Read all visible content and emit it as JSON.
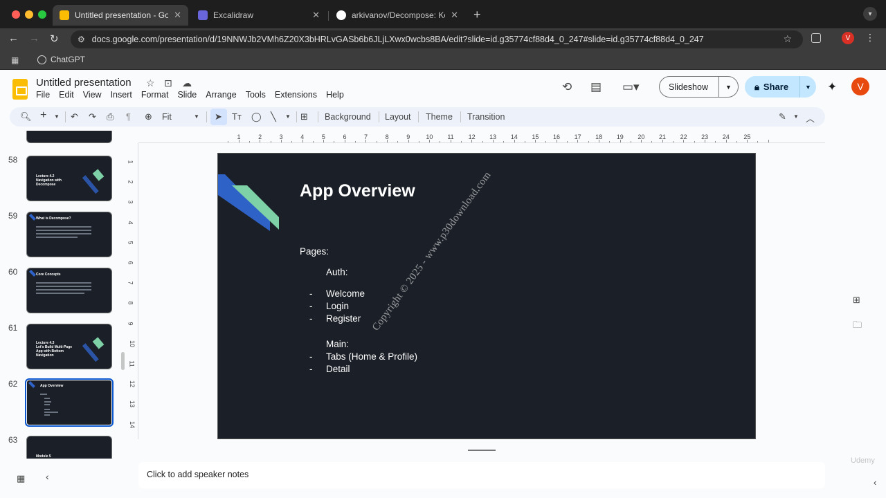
{
  "browser": {
    "tabs": [
      {
        "title": "Untitled presentation - Google Slides",
        "active": true,
        "favicon_color": "#fbbc04"
      },
      {
        "title": "Excalidraw",
        "active": false,
        "favicon_color": "#6965db"
      },
      {
        "title": "arkivanov/Decompose: Kotlin Multiplatform",
        "active": false,
        "favicon_color": "#ffffff"
      }
    ],
    "url": "docs.google.com/presentation/d/19NNWJb2VMh6Z20X3bHRLvGASb6b6JLjLXwx0wcbs8BA/edit?slide=id.g35774cf88d4_0_247#slide=id.g35774cf88d4_0_247",
    "bookmark": "ChatGPT",
    "profile_initial": "V"
  },
  "app": {
    "title": "Untitled presentation",
    "menus": [
      "File",
      "Edit",
      "View",
      "Insert",
      "Format",
      "Slide",
      "Arrange",
      "Tools",
      "Extensions",
      "Help"
    ],
    "slideshow_label": "Slideshow",
    "share_label": "Share",
    "avatar_initial": "V"
  },
  "toolbar": {
    "zoom": "Fit",
    "buttons": [
      "Background",
      "Layout",
      "Theme",
      "Transition"
    ]
  },
  "filmstrip": [
    {
      "num": "58",
      "title": "Lecture 4.2\nNavigation with Decompose",
      "selected": false
    },
    {
      "num": "59",
      "title": "What is Decompose?",
      "selected": false
    },
    {
      "num": "60",
      "title": "Core Concepts",
      "selected": false
    },
    {
      "num": "61",
      "title": "Lecture 4.3\nLet's Build Multi-Page App with Bottom Navigation",
      "selected": false
    },
    {
      "num": "62",
      "title": "App Overview",
      "selected": true
    },
    {
      "num": "63",
      "title": "Module 5",
      "selected": false
    }
  ],
  "rulers": {
    "horizontal": [
      "1",
      "2",
      "3",
      "4",
      "5",
      "6",
      "7",
      "8",
      "9",
      "10",
      "11",
      "12",
      "13",
      "14",
      "15",
      "16",
      "17",
      "18",
      "19",
      "20",
      "21",
      "22",
      "23",
      "24",
      "25"
    ],
    "vertical": [
      "1",
      "2",
      "3",
      "4",
      "5",
      "6",
      "7",
      "8",
      "9",
      "10",
      "11",
      "12",
      "13",
      "14"
    ]
  },
  "slide": {
    "title": "App Overview",
    "pages_label": "Pages:",
    "auth_label": "Auth:",
    "auth_items": [
      "Welcome",
      "Login",
      "Register"
    ],
    "main_label": "Main:",
    "main_items": [
      "Tabs (Home & Profile)",
      "Detail"
    ],
    "bullet": "-",
    "watermark": "Copyright © 2025 - www.p30download.com",
    "accent_blue": "#2f62c7",
    "accent_green": "#7ed1a6",
    "background": "#1b1f27"
  },
  "notes_placeholder": "Click to add speaker notes",
  "udemy_mark": "Udemy"
}
